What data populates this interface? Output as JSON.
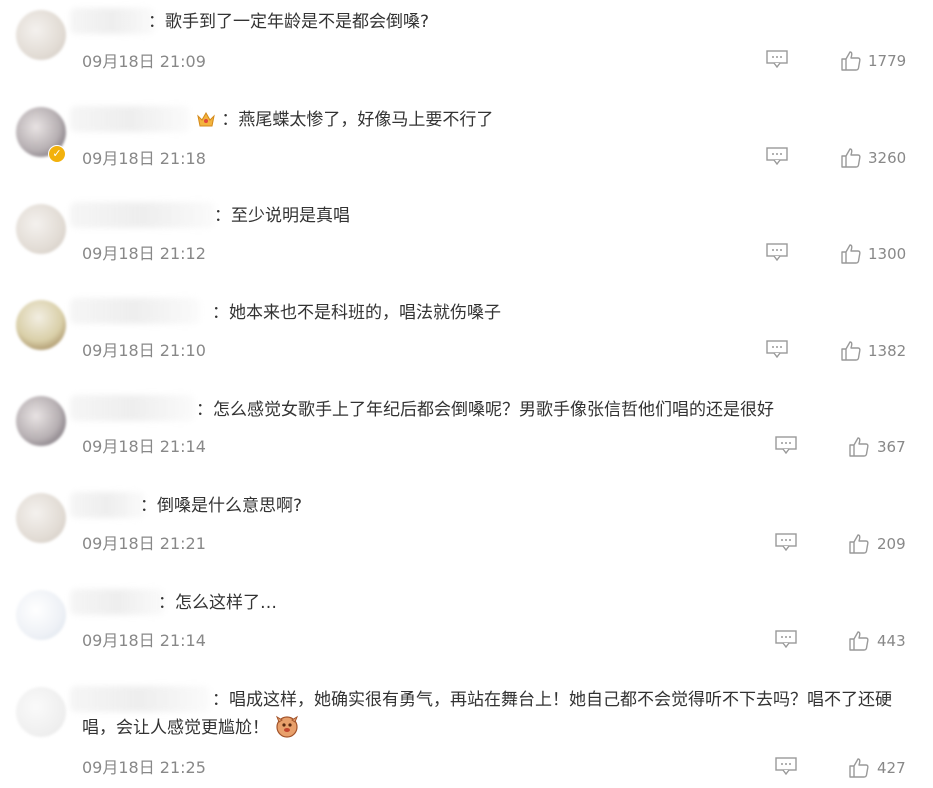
{
  "comments": [
    {
      "text": "：歌手到了一定年龄是不是都会倒嗓?",
      "time": "09月18日 21:09",
      "likes": "1779"
    },
    {
      "text": "：燕尾蝶太惨了，好像马上要不行了",
      "time": "09月18日 21:18",
      "likes": "3260"
    },
    {
      "text": "：至少说明是真唱",
      "time": "09月18日 21:12",
      "likes": "1300"
    },
    {
      "text": "：她本来也不是科班的，唱法就伤嗓子",
      "time": "09月18日 21:10",
      "likes": "1382"
    },
    {
      "text": "：怎么感觉女歌手上了年纪后都会倒嗓呢？男歌手像张信哲他们唱的还是很好",
      "time": "09月18日 21:14",
      "likes": "367"
    },
    {
      "text": "：倒嗓是什么意思啊?",
      "time": "09月18日 21:21",
      "likes": "209"
    },
    {
      "text": "：怎么这样了…",
      "time": "09月18日 21:14",
      "likes": "443"
    },
    {
      "text": "：唱成这样，她确实很有勇气，再站在舞台上！她自己都不会觉得听不下去吗？唱不了还硬唱，会让人感觉更尴尬！",
      "time": "09月18日 21:25",
      "likes": "427"
    }
  ]
}
